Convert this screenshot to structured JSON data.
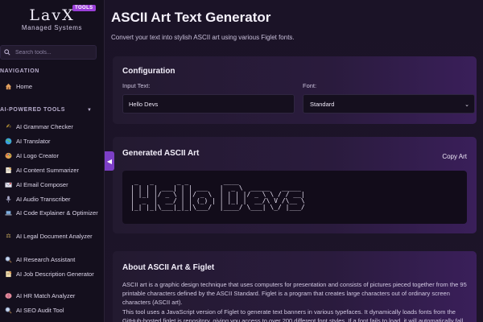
{
  "brand": {
    "name": "LavX",
    "subtitle": "Managed Systems",
    "badge": "TOOLS"
  },
  "search": {
    "placeholder": "Search tools..."
  },
  "nav": {
    "navigation_label": "NAVIGATION",
    "home_label": "Home",
    "ai_tools_label": "AI-POWERED TOOLS",
    "items": [
      {
        "label": "AI Grammar Checker",
        "icon": "pencil-icon",
        "color": "#f0c040"
      },
      {
        "label": "AI Translator",
        "icon": "globe-icon",
        "color": "#3aa0e0"
      },
      {
        "label": "AI Logo Creator",
        "icon": "palette-icon",
        "color": "#e08040"
      },
      {
        "label": "AI Content Summarizer",
        "icon": "memo-icon",
        "color": "#e0d0b0"
      },
      {
        "label": "AI Email Composer",
        "icon": "envelope-icon",
        "color": "#d0d0e0"
      },
      {
        "label": "AI Audio Transcriber",
        "icon": "microphone-icon",
        "color": "#a0a0c0"
      },
      {
        "label": "AI Code Explainer & Optimizer",
        "icon": "laptop-icon",
        "color": "#80a0c0"
      },
      {
        "label": "AI Legal Document Analyzer",
        "icon": "scales-icon",
        "color": "#d0b060"
      },
      {
        "label": "AI Research Assistant",
        "icon": "magnifier-icon",
        "color": "#b0b0d0"
      },
      {
        "label": "AI Job Description Generator",
        "icon": "notepad-icon",
        "color": "#e0c080"
      },
      {
        "label": "AI HR Match Analyzer",
        "icon": "brain-icon",
        "color": "#e08090"
      },
      {
        "label": "AI SEO Audit Tool",
        "icon": "magnifier-icon",
        "color": "#b0b0d0"
      }
    ]
  },
  "page": {
    "title": "ASCII Art Text Generator",
    "description": "Convert your text into stylish ASCII art using various Figlet fonts."
  },
  "config": {
    "title": "Configuration",
    "input_label": "Input Text:",
    "input_value": "Hello Devs",
    "font_label": "Font:",
    "font_value": "Standard"
  },
  "output": {
    "title": "Generated ASCII Art",
    "copy_label": "Copy Art",
    "ascii": " _   _      _ _         ____                 \n| | | | ___| | | ___   |  _ \\  _____   _____ \n| |_| |/ _ \\ | |/ _ \\  | | | |/ _ \\ \\ / / __|\n|  _  |  __/ | | (_) | | |_| |  __/\\ V /\\__ \\\n|_| |_|\\___|_|_|\\___/  |____/ \\___| \\_/ |___/"
  },
  "about": {
    "title": "About ASCII Art & Figlet",
    "p1": "ASCII art is a graphic design technique that uses computers for presentation and consists of pictures pieced together from the 95 printable characters defined by the ASCII Standard. Figlet is a program that creates large characters out of ordinary screen characters (ASCII art).",
    "p2": "This tool uses a JavaScript version of Figlet to generate text banners in various typefaces. It dynamically loads fonts from the GitHub-hosted figlet.js repository, giving you access to over 200 different font styles. If a font fails to load, it will automatically fall"
  },
  "colors": {
    "accent": "#9b3fd9",
    "sidebar_bg": "#140f1d",
    "main_bg": "#1b1327"
  }
}
